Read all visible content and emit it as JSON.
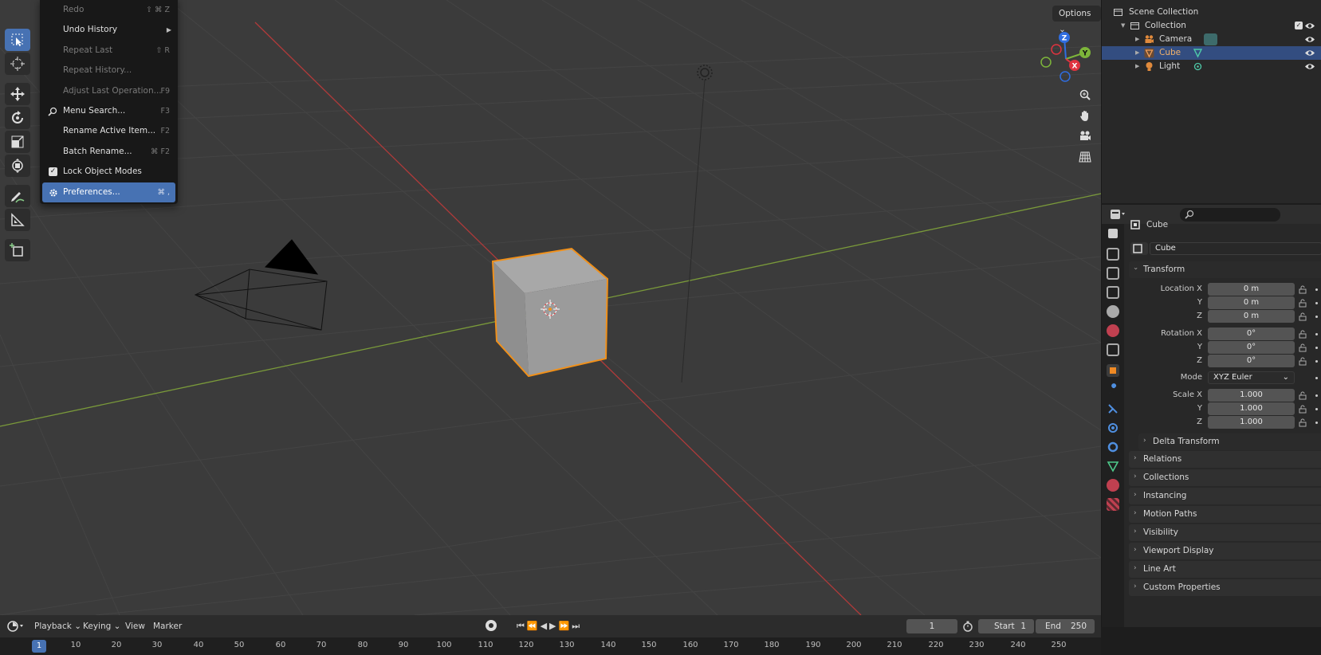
{
  "menu": {
    "items": [
      {
        "label": "Redo",
        "shortcut": "⇧ ⌘ Z",
        "disabled": true
      },
      {
        "label": "Undo History",
        "shortcut": "",
        "submenu": true
      },
      {
        "label": "Repeat Last",
        "shortcut": "⇧ R",
        "disabled": true
      },
      {
        "label": "Repeat History...",
        "shortcut": "",
        "disabled": true
      },
      {
        "label": "Adjust Last Operation...",
        "shortcut": "F9",
        "disabled": true
      },
      {
        "label": "Menu Search...",
        "shortcut": "F3",
        "icon": "search-icon"
      },
      {
        "label": "Rename Active Item...",
        "shortcut": "F2"
      },
      {
        "label": "Batch Rename...",
        "shortcut": "⌘ F2"
      },
      {
        "label": "Lock Object Modes",
        "shortcut": "",
        "checkbox": true,
        "checked": true
      },
      {
        "label": "Preferences...",
        "shortcut": "⌘ ,",
        "icon": "gear-icon",
        "highlighted": true
      }
    ]
  },
  "viewport": {
    "options_label": "Options",
    "gizmo": {
      "z": "Z",
      "y": "Y",
      "x": "X"
    }
  },
  "outliner": {
    "scene_collection": "Scene Collection",
    "collection": "Collection",
    "objects": [
      {
        "name": "Camera",
        "icon": "camera-object-icon",
        "selected": false
      },
      {
        "name": "Cube",
        "icon": "mesh-object-icon",
        "selected": true
      },
      {
        "name": "Light",
        "icon": "light-object-icon",
        "selected": false
      }
    ]
  },
  "properties": {
    "object_name": "Cube",
    "datablock_name": "Cube",
    "transform": {
      "title": "Transform",
      "location_label": "Location X",
      "location": [
        "0 m",
        "0 m",
        "0 m"
      ],
      "rotation_label": "Rotation X",
      "rotation": [
        "0°",
        "0°",
        "0°"
      ],
      "mode_label": "Mode",
      "mode_value": "XYZ Euler",
      "scale_label": "Scale X",
      "scale": [
        "1.000",
        "1.000",
        "1.000"
      ],
      "y_label": "Y",
      "z_label": "Z"
    },
    "delta_transform": "Delta Transform",
    "panels": [
      "Relations",
      "Collections",
      "Instancing",
      "Motion Paths",
      "Visibility",
      "Viewport Display",
      "Line Art",
      "Custom Properties"
    ]
  },
  "timeline": {
    "playback": "Playback",
    "keying": "Keying",
    "view": "View",
    "marker": "Marker",
    "current_frame": "1",
    "start_label": "Start",
    "start_value": "1",
    "end_label": "End",
    "end_value": "250",
    "ruler_ticks": [
      "1",
      "10",
      "20",
      "30",
      "40",
      "50",
      "60",
      "70",
      "80",
      "90",
      "100",
      "110",
      "120",
      "130",
      "140",
      "150",
      "160",
      "170",
      "180",
      "190",
      "200",
      "210",
      "220",
      "230",
      "240",
      "250"
    ]
  }
}
